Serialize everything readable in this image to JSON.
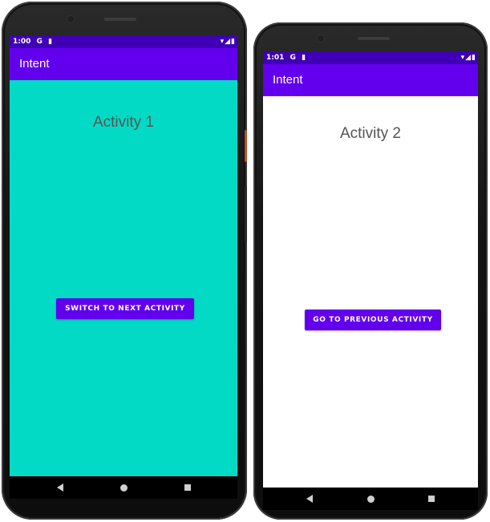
{
  "app": {
    "name": "Intent"
  },
  "screens": [
    {
      "status": {
        "time": "1:00",
        "icons_left": [
          "G",
          "▮"
        ],
        "icons_right": "▾◢▮"
      },
      "app_bar_title": "Intent",
      "activity_title": "Activity 1",
      "button_label": "SWITCH TO NEXT ACTIVITY",
      "background_color": "#03dac5"
    },
    {
      "status": {
        "time": "1:01",
        "icons_left": [
          "G",
          "▮"
        ],
        "icons_right": "▾◢▮"
      },
      "app_bar_title": "Intent",
      "activity_title": "Activity 2",
      "button_label": "GO TO PREVIOUS ACTIVITY",
      "background_color": "#ffffff"
    }
  ],
  "colors": {
    "primary": "#6200ee",
    "primary_dark": "#3f00b5",
    "accent": "#03dac5"
  },
  "nav_icons": [
    "back-icon",
    "home-icon",
    "recents-icon"
  ]
}
